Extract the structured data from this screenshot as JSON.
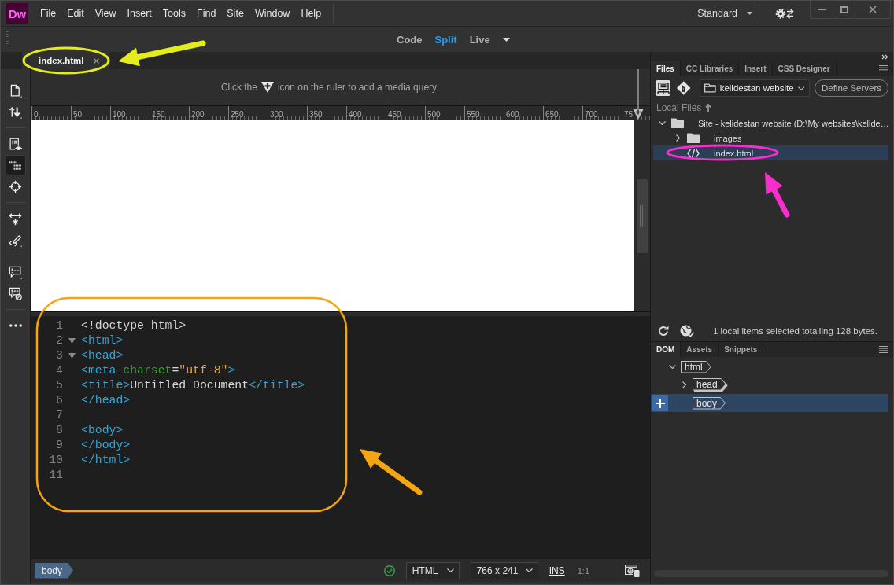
{
  "app": {
    "logo": "Dw",
    "workspace": "Standard"
  },
  "menu": [
    "File",
    "Edit",
    "View",
    "Insert",
    "Tools",
    "Find",
    "Site",
    "Window",
    "Help"
  ],
  "view_modes": [
    {
      "label": "Code",
      "selected": false
    },
    {
      "label": "Split",
      "selected": true
    },
    {
      "label": "Live",
      "selected": false
    }
  ],
  "document_tabs": [
    {
      "label": "index.html",
      "selected": true
    }
  ],
  "left_toolbar": {
    "groups": [
      {
        "tools": [
          {
            "selected": false
          },
          {
            "selected": false
          }
        ]
      },
      {
        "tools": [
          {
            "selected": false
          },
          {
            "selected": true
          },
          {
            "selected": false
          }
        ]
      },
      {
        "tools": [
          {
            "selected": false
          },
          {
            "selected": false
          }
        ]
      },
      {
        "tools": [
          {
            "selected": false
          },
          {
            "selected": false
          }
        ]
      },
      {
        "tools": [
          {
            "selected": false
          }
        ]
      }
    ]
  },
  "media_query_bar": {
    "before_icon": "Click the",
    "after_icon": "icon on the ruler to add a media query"
  },
  "ruler": {
    "labels": [
      "0",
      "50",
      "100",
      "150",
      "200",
      "250",
      "300",
      "350",
      "400",
      "450",
      "500",
      "550",
      "600",
      "650",
      "700",
      "75"
    ]
  },
  "code_view": {
    "lines": [
      {
        "number": "1",
        "tokens": [
          {
            "kind": "doctype",
            "text": "<!doctype html>"
          }
        ]
      },
      {
        "number": "2",
        "folded": false,
        "tokens": [
          {
            "kind": "tag",
            "text": "<html>"
          }
        ]
      },
      {
        "number": "3",
        "folded": false,
        "tokens": [
          {
            "kind": "tag",
            "text": "<head>"
          }
        ]
      },
      {
        "number": "4",
        "tokens": [
          {
            "kind": "tag",
            "text": "<meta"
          },
          {
            "kind": "attribute",
            "text": " charset"
          },
          {
            "kind": "plain",
            "text": "="
          },
          {
            "kind": "string",
            "text": "\"utf-8\""
          },
          {
            "kind": "tag",
            "text": ">"
          }
        ]
      },
      {
        "number": "5",
        "tokens": [
          {
            "kind": "tag",
            "text": "<title>"
          },
          {
            "kind": "plain",
            "text": "Untitled Document"
          },
          {
            "kind": "tag",
            "text": "</title>"
          }
        ]
      },
      {
        "number": "6",
        "tokens": [
          {
            "kind": "tag",
            "text": "</head>"
          }
        ]
      },
      {
        "number": "7"
      },
      {
        "number": "8",
        "tokens": [
          {
            "kind": "tag",
            "text": "<body>"
          }
        ]
      },
      {
        "number": "9",
        "tokens": [
          {
            "kind": "tag",
            "text": "</body>"
          }
        ]
      },
      {
        "number": "10",
        "tokens": [
          {
            "kind": "tag",
            "text": "</html>"
          }
        ]
      },
      {
        "number": "11"
      }
    ]
  },
  "status_bar": {
    "tag": "body",
    "language": "HTML",
    "size": "766 x 241",
    "insert_mode": "INS",
    "zoom": "1:1"
  },
  "files_panel": {
    "tabs": [
      {
        "label": "Files",
        "selected": true
      },
      {
        "label": "CC Libraries",
        "selected": false
      },
      {
        "label": "Insert",
        "selected": false
      },
      {
        "label": "CSS Designer",
        "selected": false
      }
    ],
    "site": "kelidestan website",
    "define_servers": "Define Servers",
    "local_files": "Local Files",
    "tree": [
      {
        "kind": "site",
        "label": "Site - kelidestan website (D:\\My websites\\kelide…",
        "expanded": true,
        "selected": false,
        "children": [
          {
            "kind": "folder",
            "label": "images",
            "expanded": false,
            "selected": false
          },
          {
            "kind": "file",
            "label": "index.html",
            "selected": true
          }
        ]
      }
    ],
    "status": "1 local items selected totalling 128 bytes."
  },
  "dom_panel": {
    "tabs": [
      {
        "label": "DOM",
        "selected": true
      },
      {
        "label": "Assets",
        "selected": false
      },
      {
        "label": "Snippets",
        "selected": false
      }
    ],
    "tree": [
      {
        "tag": "html",
        "expanded": true,
        "selected": false,
        "children": [
          {
            "tag": "head",
            "expanded": false,
            "selected": false
          },
          {
            "tag": "body",
            "selected": true
          }
        ]
      }
    ]
  },
  "annotations": [
    {
      "kind": "ellipse",
      "color": "#e4ec1c"
    },
    {
      "kind": "arrow",
      "color": "#e4ec1c"
    },
    {
      "kind": "ellipse",
      "color": "#f72ecb"
    },
    {
      "kind": "arrow",
      "color": "#f72ecb"
    },
    {
      "kind": "frame",
      "color": "#f5a511"
    },
    {
      "kind": "arrow",
      "color": "#f5a511"
    }
  ]
}
